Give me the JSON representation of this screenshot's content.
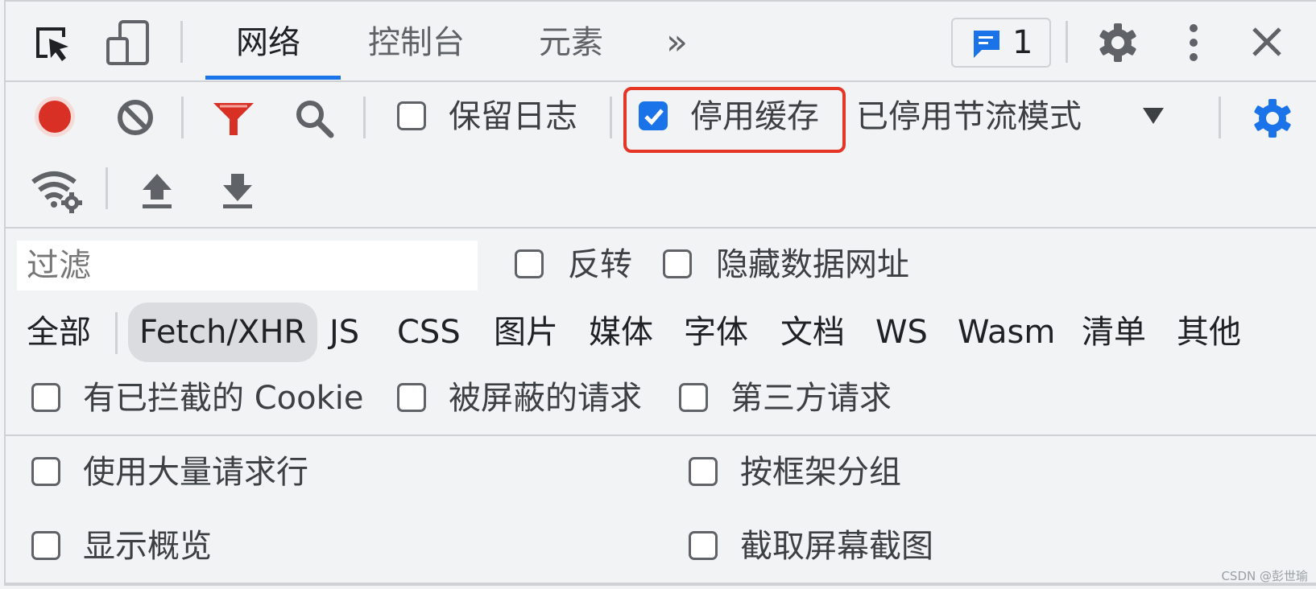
{
  "toolbar_top": {
    "tabs": [
      {
        "label": "网络",
        "active": true
      },
      {
        "label": "控制台",
        "active": false
      },
      {
        "label": "元素",
        "active": false
      }
    ],
    "more_tabs": "»",
    "issues_count": "1",
    "icons": [
      "inspect-icon",
      "device-toggle-icon",
      "more-tabs-icon",
      "issues-icon",
      "settings-icon",
      "kebab-menu-icon",
      "close-icon"
    ]
  },
  "network_toolbar": {
    "preserve_log_label": "保留日志",
    "preserve_log_checked": false,
    "disable_cache_label": "停用缓存",
    "disable_cache_checked": true,
    "throttling_value": "已停用节流模式",
    "accent_color": "#1a73e8",
    "record_color": "#d93025",
    "highlight_color": "#e53524"
  },
  "filter_bar": {
    "placeholder": "过滤",
    "invert_label": "反转",
    "hide_data_urls_label": "隐藏数据网址",
    "types": [
      "全部",
      "Fetch/XHR",
      "JS",
      "CSS",
      "图片",
      "媒体",
      "字体",
      "文档",
      "WS",
      "Wasm",
      "清单",
      "其他"
    ],
    "active_type": "Fetch/XHR",
    "blocked_cookies_label": "有已拦截的 Cookie",
    "blocked_requests_label": "被屏蔽的请求",
    "third_party_label": "第三方请求"
  },
  "settings_panel": {
    "big_request_rows_label": "使用大量请求行",
    "group_by_frame_label": "按框架分组",
    "show_overview_label": "显示概览",
    "capture_screenshots_label": "截取屏幕截图"
  },
  "watermark": "CSDN @彭世瑜"
}
